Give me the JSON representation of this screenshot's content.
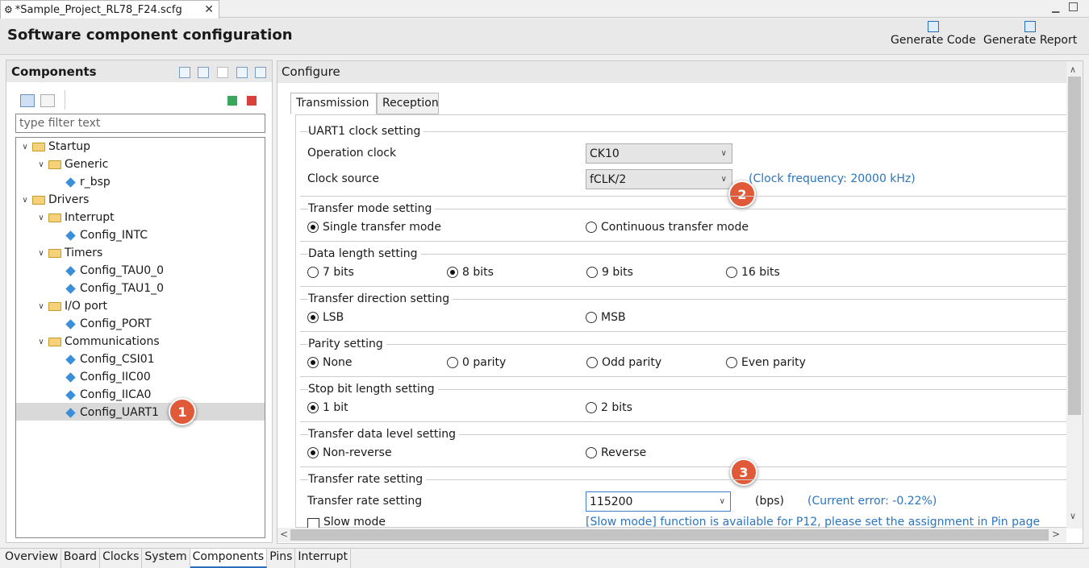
{
  "editor": {
    "tab_title": "*Sample_Project_RL78_F24.scfg",
    "close_glyph": "✕"
  },
  "header": {
    "title": "Software component configuration",
    "generate_code": "Generate Code",
    "generate_report": "Generate Report"
  },
  "components": {
    "title": "Components",
    "filter_placeholder": "type filter text",
    "tree": [
      {
        "label": "Startup"
      },
      {
        "label": "Generic"
      },
      {
        "label": "r_bsp"
      },
      {
        "label": "Drivers"
      },
      {
        "label": "Interrupt"
      },
      {
        "label": "Config_INTC"
      },
      {
        "label": "Timers"
      },
      {
        "label": "Config_TAU0_0"
      },
      {
        "label": "Config_TAU1_0"
      },
      {
        "label": "I/O port"
      },
      {
        "label": "Config_PORT"
      },
      {
        "label": "Communications"
      },
      {
        "label": "Config_CSI01"
      },
      {
        "label": "Config_IIC00"
      },
      {
        "label": "Config_IICA0"
      },
      {
        "label": "Config_UART1"
      }
    ]
  },
  "configure": {
    "title": "Configure",
    "tabs": [
      "Transmission",
      "Reception"
    ],
    "groups": {
      "clock": {
        "title": "UART1 clock setting",
        "op_label": "Operation clock",
        "op_value": "CK10",
        "src_label": "Clock source",
        "src_value": "fCLK/2",
        "freq_note": "(Clock frequency: 20000 kHz)"
      },
      "mode": {
        "title": "Transfer mode setting",
        "opts": [
          "Single transfer mode",
          "Continuous transfer mode"
        ]
      },
      "length": {
        "title": "Data length setting",
        "opts": [
          "7 bits",
          "8 bits",
          "9 bits",
          "16 bits"
        ]
      },
      "direction": {
        "title": "Transfer direction setting",
        "opts": [
          "LSB",
          "MSB"
        ]
      },
      "parity": {
        "title": "Parity setting",
        "opts": [
          "None",
          "0 parity",
          "Odd parity",
          "Even parity"
        ]
      },
      "stop": {
        "title": "Stop bit length setting",
        "opts": [
          "1 bit",
          "2 bits"
        ]
      },
      "level": {
        "title": "Transfer data level setting",
        "opts": [
          "Non-reverse",
          "Reverse"
        ]
      },
      "rate": {
        "title": "Transfer rate setting",
        "label": "Transfer rate setting",
        "value": "115200",
        "unit": "(bps)",
        "error_note": "(Current error: -0.22%)",
        "slow_label": "Slow mode",
        "slow_note": "[Slow mode] function is available for P12, please set the assignment in Pin page"
      }
    }
  },
  "badges": [
    "1",
    "2",
    "3"
  ],
  "bottom_tabs": [
    "Overview",
    "Board",
    "Clocks",
    "System",
    "Components",
    "Pins",
    "Interrupt"
  ]
}
